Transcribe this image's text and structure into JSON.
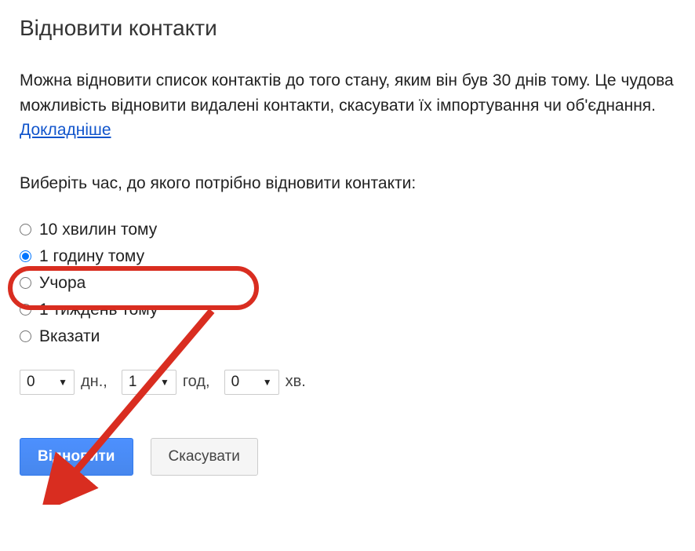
{
  "title": "Відновити контакти",
  "description": "Можна відновити список контактів до того стану, яким він був 30 днів тому. Це чудова можливість відновити видалені контакти, скасувати їх імпортування чи об'єднання.",
  "learn_more": "Докладніше",
  "prompt": "Виберіть час, до якого потрібно відновити контакти:",
  "options": {
    "opt0": "10 хвилин тому",
    "opt1": "1 годину тому",
    "opt2": "Учора",
    "opt3": "1 тиждень тому",
    "opt4": "Вказати"
  },
  "selected_option": "opt1",
  "custom": {
    "days_value": "0",
    "days_unit": "дн.,",
    "hours_value": "1",
    "hours_unit": "год,",
    "minutes_value": "0",
    "minutes_unit": "хв."
  },
  "buttons": {
    "restore": "Відновити",
    "cancel": "Скасувати"
  },
  "annotation": {
    "highlight_color": "#d92d20"
  }
}
